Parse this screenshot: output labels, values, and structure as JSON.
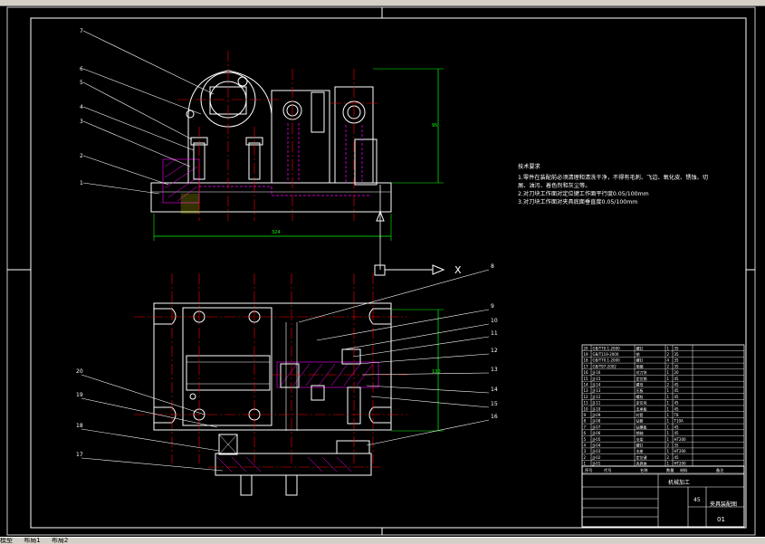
{
  "tech": {
    "title": "技术要求",
    "lines": [
      "1.零件在装配前必须清理和清洗干净，不得有毛刺、飞边、氧化皮、锈蚀、切",
      "  屑、油污、着色剂和灰尘等。",
      "2.对刀块工作面对定位键工作面平行度0.05/100mm",
      "3.对刀块工作面对夹具底面垂直度0.05/100mm"
    ]
  },
  "balloons_top": [
    "7",
    "6",
    "5",
    "4",
    "3",
    "2",
    "1"
  ],
  "balloons_right": [
    "8",
    "9",
    "10",
    "11",
    "12",
    "13",
    "14",
    "15",
    "16"
  ],
  "balloons_left": [
    "20",
    "19",
    "18",
    "17"
  ],
  "dims": {
    "overall_width": "324",
    "height_right": "95",
    "plan_height": "130"
  },
  "datum_letter": "X",
  "title_block": {
    "drawing_name": "夹具装配图",
    "material": "45",
    "sheet_no": "01",
    "company": "机械加工",
    "header_cells": [
      "序号",
      "代号",
      "名称",
      "数量",
      "材料",
      "备注"
    ]
  },
  "bom_rows": [
    [
      "20",
      "GB/T70.1-2000",
      "螺钉",
      "1",
      "35"
    ],
    [
      "19",
      "GB/T119-2000",
      "销",
      "2",
      "35"
    ],
    [
      "18",
      "GB/T70.1-2000",
      "螺钉",
      "4",
      "35"
    ],
    [
      "17",
      "GB/T97-2002",
      "垫圈",
      "2",
      "35"
    ],
    [
      "16",
      "JJ-16",
      "对刀块",
      "1",
      "20"
    ],
    [
      "15",
      "JJ-15",
      "定位销",
      "1",
      "45"
    ],
    [
      "14",
      "JJ-14",
      "螺母",
      "2",
      "45"
    ],
    [
      "13",
      "JJ-13",
      "压板",
      "1",
      "45"
    ],
    [
      "12",
      "JJ-12",
      "螺栓",
      "1",
      "45"
    ],
    [
      "11",
      "JJ-11",
      "定位块",
      "1",
      "45"
    ],
    [
      "10",
      "JJ-10",
      "支承板",
      "1",
      "45"
    ],
    [
      "9",
      "JJ-09",
      "衬套",
      "1",
      "T8"
    ],
    [
      "8",
      "JJ-08",
      "钻套",
      "1",
      "T10A"
    ],
    [
      "7",
      "JJ-07",
      "钻模板",
      "1",
      "45"
    ],
    [
      "6",
      "JJ-06",
      "销轴",
      "1",
      "45"
    ],
    [
      "5",
      "JJ-05",
      "支架",
      "1",
      "HT200"
    ],
    [
      "4",
      "JJ-04",
      "螺钉",
      "2",
      "35"
    ],
    [
      "3",
      "JJ-03",
      "支座",
      "1",
      "HT200"
    ],
    [
      "2",
      "JJ-02",
      "定位键",
      "2",
      "45"
    ],
    [
      "1",
      "JJ-01",
      "夹具体",
      "1",
      "HT200"
    ]
  ],
  "status": {
    "items": [
      "模型",
      "布局1",
      "布局2"
    ]
  },
  "colors": {
    "bg": "#000000",
    "frame": "#ffffff",
    "red": "#ff0000",
    "magenta": "#ff00ff",
    "green": "#00ff00",
    "yellow": "#ffff00",
    "cyan": "#00ffff"
  }
}
